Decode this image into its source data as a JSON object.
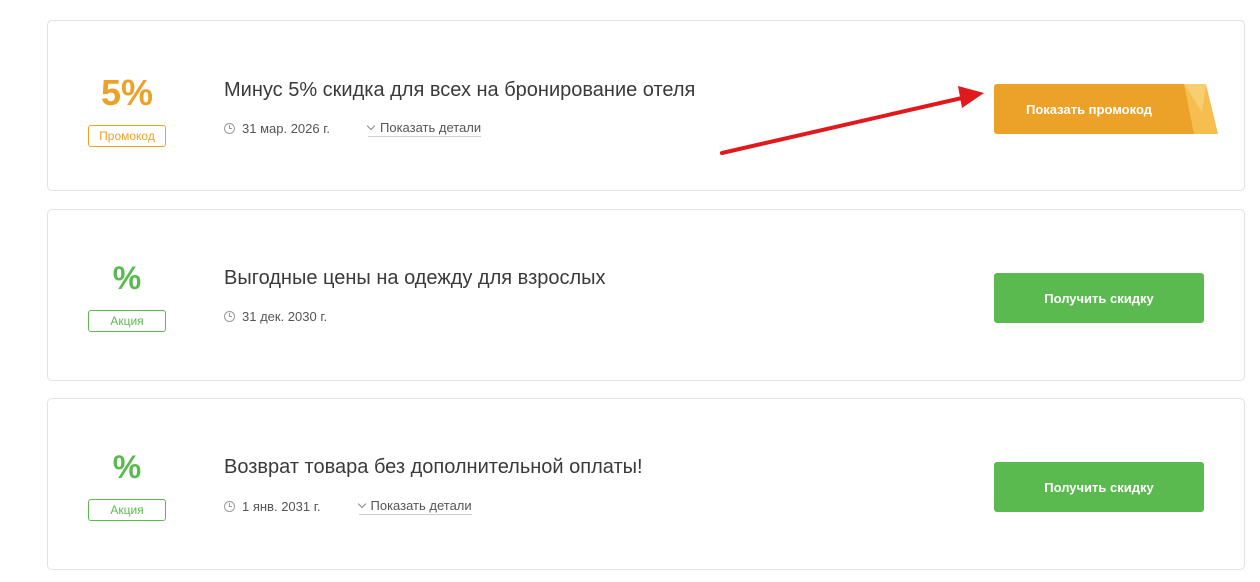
{
  "offers": [
    {
      "value": "5%",
      "badge": "Промокод",
      "title": "Минус 5% скидка для всех на бронирование отеля",
      "date": "31 мар. 2026 г.",
      "details_label": "Показать детали",
      "button_label": "Показать промокод"
    },
    {
      "value": "%",
      "badge": "Акция",
      "title": "Выгодные цены на одежду для взрослых",
      "date": "31 дек. 2030 г.",
      "button_label": "Получить скидку"
    },
    {
      "value": "%",
      "badge": "Акция",
      "title": "Возврат товара без дополнительной оплаты!",
      "date": "1 янв. 2031 г.",
      "details_label": "Показать детали",
      "button_label": "Получить скидку"
    }
  ],
  "colors": {
    "promo_accent": "#eca129",
    "deal_accent": "#5bba4f",
    "annotation_arrow": "#e0191c"
  },
  "icons": [
    "clock-icon",
    "chevron-down-icon",
    "red-arrow-annotation"
  ]
}
